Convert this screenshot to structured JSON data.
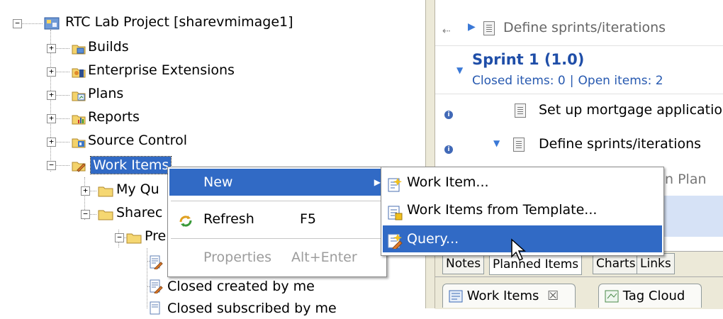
{
  "tree": {
    "root_label": "RTC Lab Project [sharevmimage1]",
    "items": [
      {
        "label": "Builds",
        "icon": "builds-icon"
      },
      {
        "label": "Enterprise Extensions",
        "icon": "enterprise-extensions-icon"
      },
      {
        "label": "Plans",
        "icon": "plans-icon"
      },
      {
        "label": "Reports",
        "icon": "reports-icon"
      },
      {
        "label": "Source Control",
        "icon": "source-control-icon"
      }
    ],
    "work_items_label": "Work Items",
    "my_queries_label": "My Qu",
    "shared_label": "Sharec",
    "pre_label": "Pre",
    "query_label": "Closed created by me",
    "query_cut_label": "Closed subscribed by me"
  },
  "plan": {
    "row1_label": "Define sprints/iterations",
    "sprint_title": "Sprint 1 (1.0)",
    "closed_items": "Closed items: 0",
    "link_sep": "|",
    "open_items": "Open items: 2",
    "item1": "Set up mortgage applicatio",
    "item2": "Define sprints/iterations",
    "item3_partial": "n Plan"
  },
  "editor_tabs": [
    "Notes",
    "Planned Items",
    "Charts",
    "Links"
  ],
  "view_tabs": {
    "work_items": "Work Items",
    "work_items_close": "☒",
    "tag_cloud": "Tag Cloud"
  },
  "context_menu": {
    "new": "New",
    "refresh": "Refresh",
    "refresh_shortcut": "F5",
    "properties": "Properties",
    "properties_shortcut": "Alt+Enter"
  },
  "submenu": {
    "work_item": "Work Item...",
    "from_template": "Work Items from Template...",
    "query": "Query..."
  },
  "colors": {
    "selection": "#316ac5",
    "link": "#2759b0",
    "sprint": "#1f4ea8"
  }
}
